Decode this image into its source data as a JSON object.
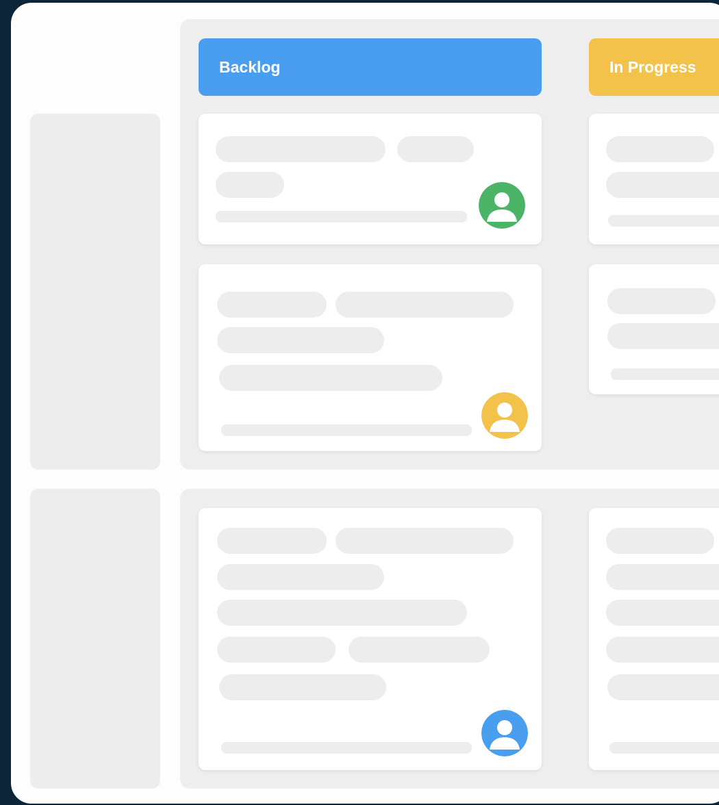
{
  "board": {
    "columns": [
      {
        "title": "Backlog",
        "color": "#4a9ef0"
      },
      {
        "title": "In Progress",
        "color": "#f3c24a"
      }
    ]
  },
  "avatars": [
    {
      "icon": "user-avatar-icon",
      "color": "#4cb466"
    },
    {
      "icon": "user-avatar-icon",
      "color": "#f3c24a"
    },
    {
      "icon": "user-avatar-icon",
      "color": "#4a9ef0"
    }
  ]
}
